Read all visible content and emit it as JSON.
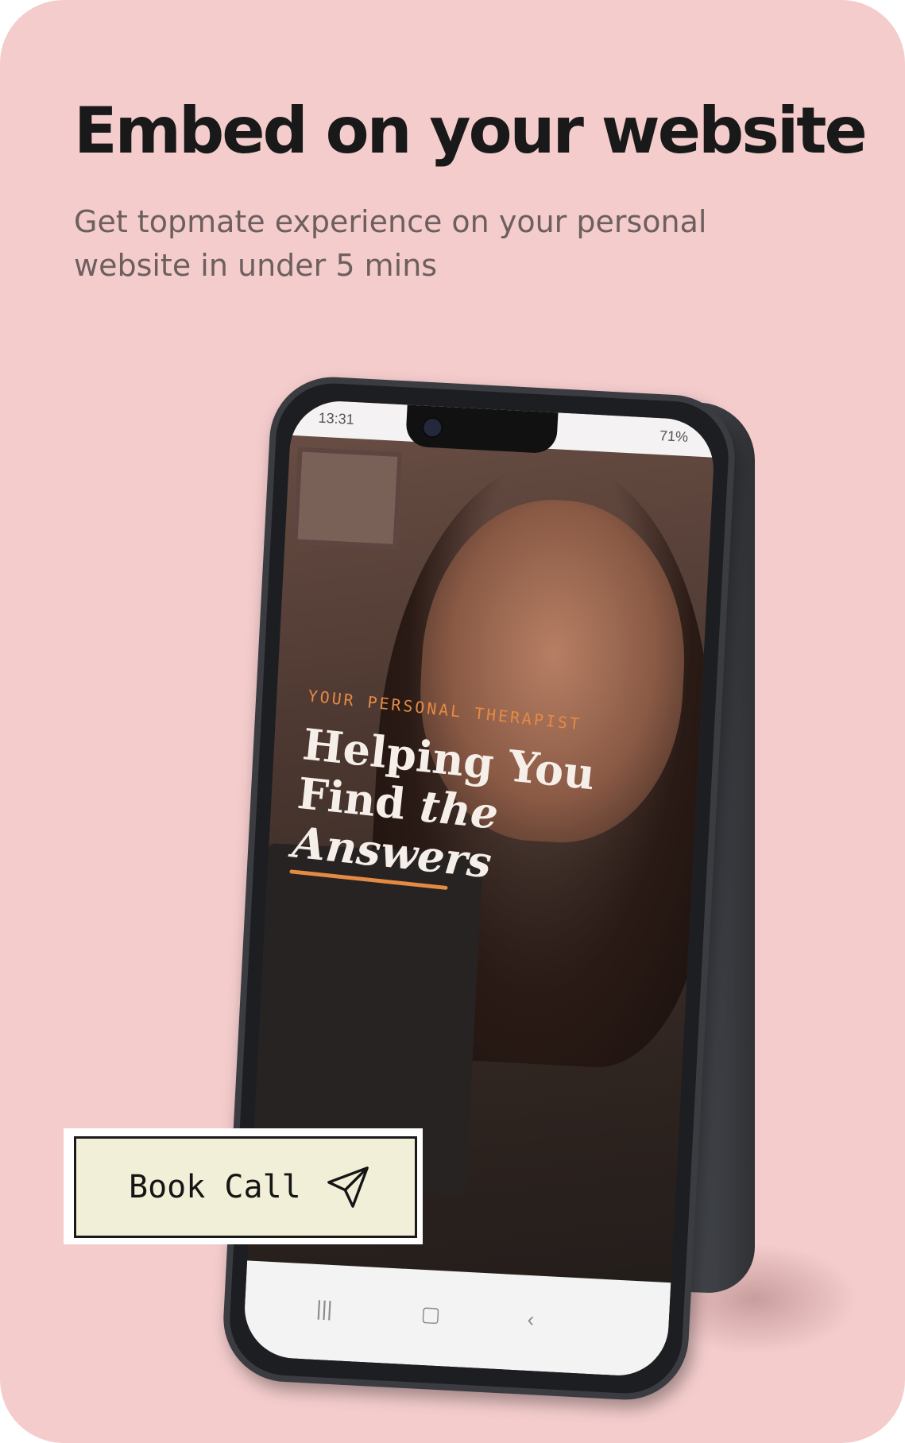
{
  "header": {
    "title": "Embed on your website",
    "subtitle_line1": "Get topmate experience on your personal",
    "subtitle_line2": "website in under 5 mins"
  },
  "phone": {
    "status_time": "13:31",
    "status_battery": "71%",
    "hero": {
      "eyebrow": "YOUR PERSONAL THERAPIST",
      "line1": "Helping You",
      "line2_a": "Find ",
      "line2_b": "the",
      "line3": "Answers"
    },
    "nav_icons": [
      "recent-apps-icon",
      "home-icon",
      "back-icon"
    ]
  },
  "cta": {
    "label": "Book Call",
    "icon": "send-icon"
  },
  "colors": {
    "background": "#f4cccc",
    "accent": "#e58a43",
    "button_bg": "#f1efd7"
  }
}
